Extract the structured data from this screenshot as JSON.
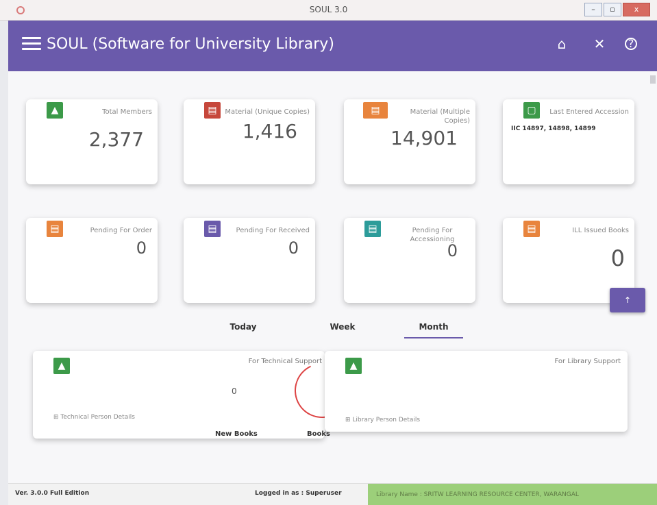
{
  "window": {
    "title": "SOUL 3.0",
    "minimize": "–",
    "maximize": "▫",
    "close": "x"
  },
  "header": {
    "title": "SOUL (Software for University Library)",
    "home_icon": "home-icon",
    "close_icon": "close-icon",
    "help_icon": "help-icon"
  },
  "cards": [
    {
      "label": "Total Members",
      "value": "2,377",
      "color": "#3c9a49"
    },
    {
      "label": "Material (Unique Copies)",
      "value": "1,416",
      "color": "#c6473b"
    },
    {
      "label": "Material (Multiple Copies)",
      "value": "14,901",
      "color": "#e8843d"
    },
    {
      "label": "Last Entered Accession",
      "value": "",
      "sub": "IIC 14897, 14898, 14899",
      "color": "#3c9a49"
    },
    {
      "label": "Pending For Order",
      "value": "0",
      "color": "#e8843d"
    },
    {
      "label": "Pending For Received",
      "value": "0",
      "color": "#6a5aab"
    },
    {
      "label": "Pending For Accessioning",
      "value": "0",
      "color": "#2c9c9a"
    },
    {
      "label": "ILL Issued Books",
      "value": "0",
      "color": "#e8843d"
    }
  ],
  "tabs": [
    {
      "label": "Today"
    },
    {
      "label": "Week"
    },
    {
      "label": "Month",
      "active": true
    }
  ],
  "panels": {
    "technical": {
      "title": "For Technical Support",
      "value": "0",
      "link": "Technical Person Details"
    },
    "library": {
      "title": "For Library Support",
      "link": "Library Person Details"
    }
  },
  "under_labels": {
    "new_books": "New Books",
    "books": "Books"
  },
  "fab": {
    "label": "↑"
  },
  "status": {
    "version": "Ver. 3.0.0  Full Edition",
    "logged": "Logged in as : Superuser",
    "library": "Library Name : SRITW LEARNING RESOURCE CENTER, WARANGAL"
  },
  "icons": {
    "member": "person-icon",
    "book": "book-icon"
  }
}
